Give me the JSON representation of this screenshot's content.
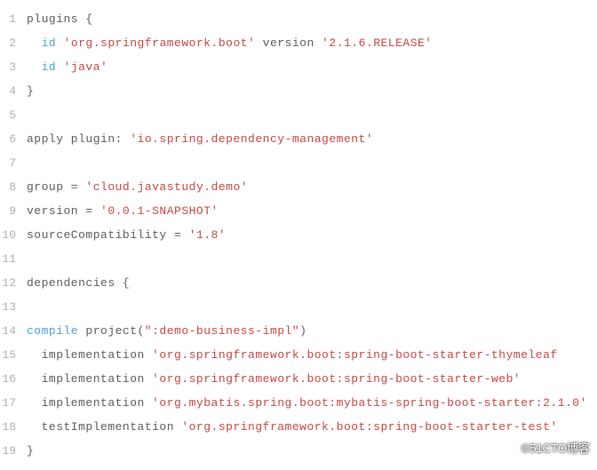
{
  "lines": [
    {
      "n": "1",
      "segs": [
        {
          "t": "plugins {",
          "c": "code"
        }
      ]
    },
    {
      "n": "2",
      "segs": [
        {
          "t": "  ",
          "c": "code"
        },
        {
          "t": "id",
          "c": "kw"
        },
        {
          "t": " ",
          "c": "code"
        },
        {
          "t": "'org.springframework.boot'",
          "c": "str"
        },
        {
          "t": " version ",
          "c": "code"
        },
        {
          "t": "'2.1.6.RELEASE'",
          "c": "str"
        }
      ]
    },
    {
      "n": "3",
      "segs": [
        {
          "t": "  ",
          "c": "code"
        },
        {
          "t": "id",
          "c": "kw"
        },
        {
          "t": " ",
          "c": "code"
        },
        {
          "t": "'java'",
          "c": "str"
        }
      ]
    },
    {
      "n": "4",
      "segs": [
        {
          "t": "}",
          "c": "code"
        }
      ]
    },
    {
      "n": "5",
      "segs": [
        {
          "t": "",
          "c": "code"
        }
      ]
    },
    {
      "n": "6",
      "segs": [
        {
          "t": "apply plugin: ",
          "c": "code"
        },
        {
          "t": "'io.spring.dependency-management'",
          "c": "str"
        }
      ]
    },
    {
      "n": "7",
      "segs": [
        {
          "t": "",
          "c": "code"
        }
      ]
    },
    {
      "n": "8",
      "segs": [
        {
          "t": "group = ",
          "c": "code"
        },
        {
          "t": "'cloud.javastudy.demo'",
          "c": "str"
        }
      ]
    },
    {
      "n": "9",
      "segs": [
        {
          "t": "version = ",
          "c": "code"
        },
        {
          "t": "'0.0.1-SNAPSHOT'",
          "c": "str"
        }
      ]
    },
    {
      "n": "10",
      "segs": [
        {
          "t": "sourceCompatibility = ",
          "c": "code"
        },
        {
          "t": "'1.8'",
          "c": "str"
        }
      ]
    },
    {
      "n": "11",
      "segs": [
        {
          "t": "",
          "c": "code"
        }
      ]
    },
    {
      "n": "12",
      "segs": [
        {
          "t": "dependencies {",
          "c": "code"
        }
      ]
    },
    {
      "n": "13",
      "segs": [
        {
          "t": "",
          "c": "code"
        }
      ]
    },
    {
      "n": "14",
      "segs": [
        {
          "t": "compile",
          "c": "kw"
        },
        {
          "t": " project(",
          "c": "code"
        },
        {
          "t": "\":demo-business-impl\"",
          "c": "str"
        },
        {
          "t": ")",
          "c": "code"
        }
      ]
    },
    {
      "n": "15",
      "segs": [
        {
          "t": "  implementation ",
          "c": "code"
        },
        {
          "t": "'org.springframework.boot:spring-boot-starter-thymeleaf",
          "c": "str"
        }
      ]
    },
    {
      "n": "16",
      "segs": [
        {
          "t": "  implementation ",
          "c": "code"
        },
        {
          "t": "'org.springframework.boot:spring-boot-starter-web'",
          "c": "str"
        }
      ]
    },
    {
      "n": "17",
      "segs": [
        {
          "t": "  implementation ",
          "c": "code"
        },
        {
          "t": "'org.mybatis.spring.boot:mybatis-spring-boot-starter:2.1.0'",
          "c": "str"
        }
      ]
    },
    {
      "n": "18",
      "segs": [
        {
          "t": "  testImplementation ",
          "c": "code"
        },
        {
          "t": "'org.springframework.boot:spring-boot-starter-test'",
          "c": "str"
        }
      ]
    },
    {
      "n": "19",
      "segs": [
        {
          "t": "}",
          "c": "code"
        }
      ]
    }
  ],
  "watermark": "©51CTO博客"
}
